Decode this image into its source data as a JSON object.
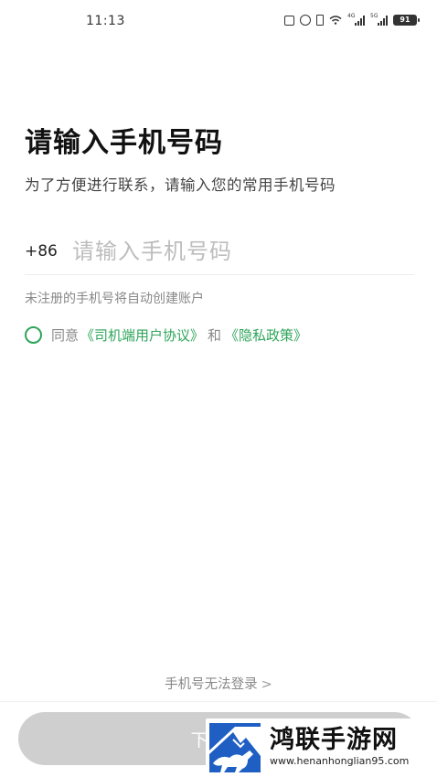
{
  "status_bar": {
    "time": "11:13",
    "signal1_tag": "4G",
    "signal2_tag": "5G",
    "battery": "91"
  },
  "login": {
    "title": "请输入手机号码",
    "subtitle": "为了方便进行联系，请输入您的常用手机号码",
    "country_code": "+86",
    "phone_placeholder": "请输入手机号码",
    "hint": "未注册的手机号将自动创建账户",
    "agree_prefix": "同意",
    "agreement_link": "《司机端用户协议》",
    "and_text": "和",
    "privacy_link": "《隐私政策》"
  },
  "footer": {
    "cannot_login": "手机号无法登录",
    "cannot_login_chevron": ">",
    "next_button": "下一步"
  },
  "watermark": {
    "title": "鸿联手游网",
    "url": "www.henanhonglian95.com"
  },
  "colors": {
    "accent": "#2ea55a",
    "button_disabled": "#cfcfcf"
  }
}
